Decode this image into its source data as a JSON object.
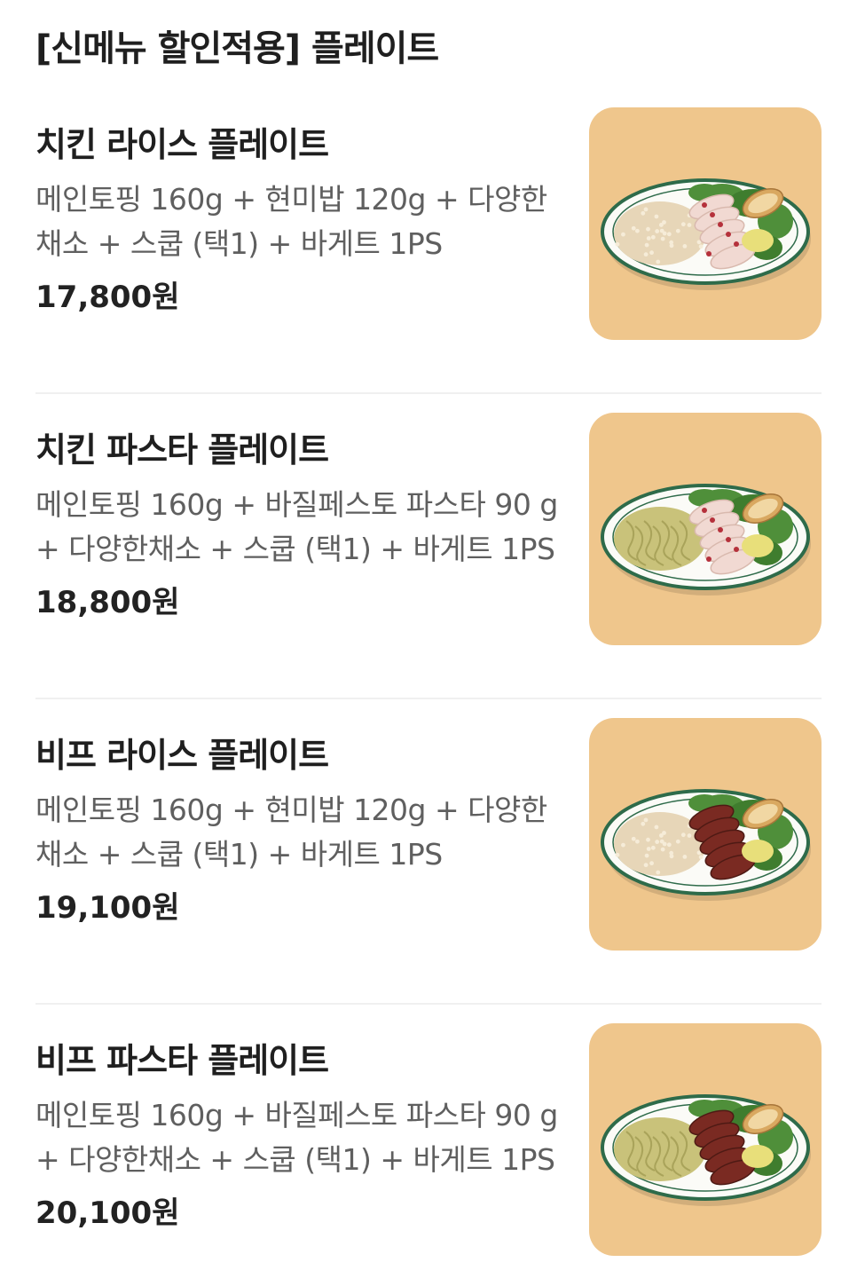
{
  "section": {
    "title": "[신메뉴 할인적용] 플레이트"
  },
  "menu": {
    "items": [
      {
        "name": "치킨 라이스 플레이트",
        "description": "메인토핑 160g + 현미밥 120g + 다양한 채소 + 스쿱 (택1) + 바게트 1PS",
        "price": "17,800원",
        "topping": "chicken",
        "base": "rice"
      },
      {
        "name": "치킨 파스타 플레이트",
        "description": "메인토핑 160g + 바질페스토 파스타 90 g + 다양한채소 + 스쿱 (택1) + 바게트 1PS",
        "price": "18,800원",
        "topping": "chicken",
        "base": "pasta"
      },
      {
        "name": "비프 라이스 플레이트",
        "description": "메인토핑 160g + 현미밥 120g + 다양한 채소 + 스쿱 (택1) + 바게트 1PS",
        "price": "19,100원",
        "topping": "beef",
        "base": "rice"
      },
      {
        "name": "비프 파스타 플레이트",
        "description": "메인토핑 160g + 바질페스토 파스타 90 g + 다양한채소 + 스쿱 (택1) + 바게트 1PS",
        "price": "20,100원",
        "topping": "beef",
        "base": "pasta"
      }
    ]
  },
  "colors": {
    "thumb_background": "#efc68c",
    "plate_rim": "#2e6b4a",
    "chicken": "#f1d9d2",
    "beef": "#7a2a22",
    "rice": "#e7d6b8",
    "pasta": "#c9c27a",
    "greens": "#4f8f3a"
  }
}
